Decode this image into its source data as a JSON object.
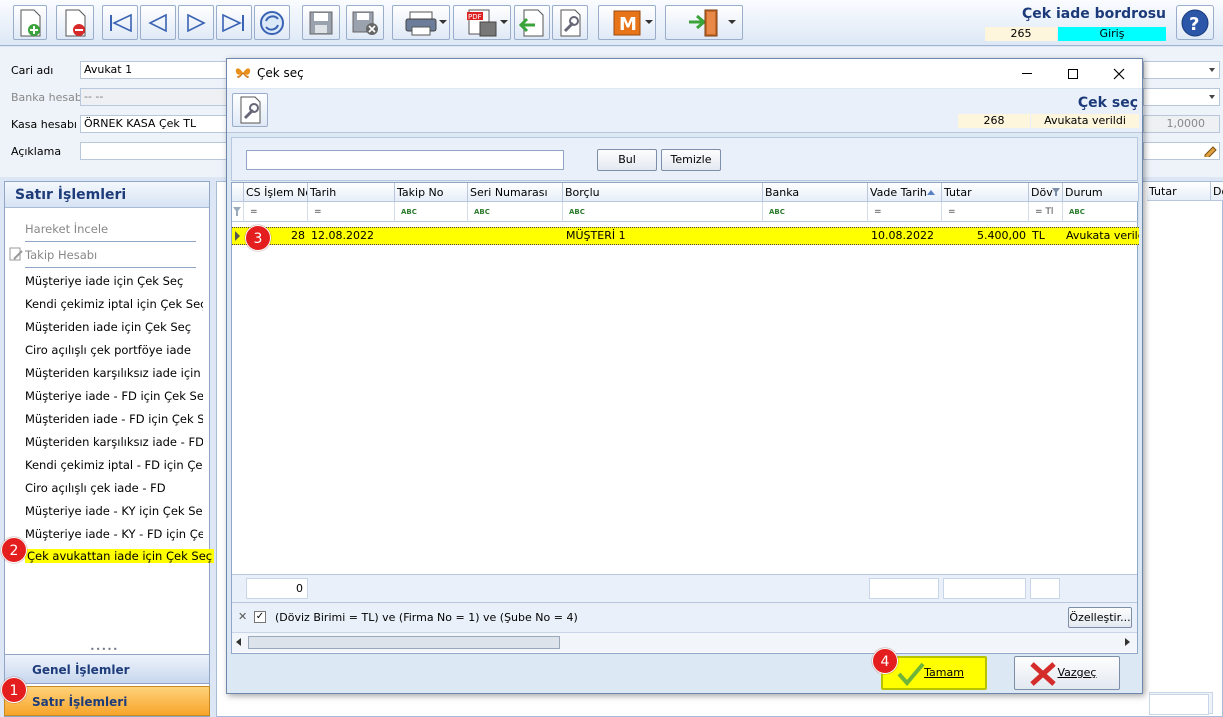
{
  "toolbar": {
    "doc_title": "Çek iade bordrosu",
    "doc_no": "265",
    "doc_status": "Giriş",
    "accent_cyan": "#00ffff",
    "icons": [
      "new-doc-icon",
      "delete-doc-icon",
      "first-icon",
      "prev-icon",
      "next-icon",
      "last-icon",
      "refresh-icon",
      "save-icon",
      "save-close-icon",
      "print-icon",
      "pdf-icon",
      "import-icon",
      "settings-icon",
      "m-icon",
      "exit-icon",
      "help-icon"
    ]
  },
  "form": {
    "cari_label": "Cari adı",
    "cari_value": "Avukat 1",
    "banka_label": "Banka hesabı",
    "banka_value": "-- --",
    "kasa_label": "Kasa hesabı",
    "kasa_value": "ÖRNEK KASA Çek TL",
    "aciklama_label": "Açıklama",
    "aciklama_value": "",
    "rate_value": "1,0000"
  },
  "left_panel": {
    "header": "Satır İşlemleri",
    "items": [
      {
        "label": "Hareket İncele",
        "disabled": true
      },
      {
        "label": "Takip Hesabı",
        "disabled": true
      },
      {
        "label": "Müşteriye iade için Çek Seç"
      },
      {
        "label": "Kendi çekimiz iptal için Çek Seç"
      },
      {
        "label": "Müşteriden iade için Çek Seç"
      },
      {
        "label": "Ciro açılışlı çek portföye iade"
      },
      {
        "label": "Müşteriden karşılıksız iade için ..."
      },
      {
        "label": "Müşteriye iade - FD için Çek Seç"
      },
      {
        "label": "Müşteriden iade - FD için Çek Seç"
      },
      {
        "label": "Müşteriden karşılıksız iade - FD i..."
      },
      {
        "label": "Kendi çekimiz iptal - FD için Çe..."
      },
      {
        "label": "Ciro açılışlı çek iade - FD"
      },
      {
        "label": "Müşteriye iade - KY için Çek Seç"
      },
      {
        "label": "Müşteriye iade - KY - FD için Çe..."
      },
      {
        "label": "Çek avukattan iade için Çek Seç",
        "highlight": true
      }
    ],
    "accordion": [
      {
        "label": "Genel İşlemler"
      },
      {
        "label": "Satır İşlemleri",
        "active": true
      }
    ]
  },
  "background_grid": {
    "columns": [
      "Tutar",
      "Dö"
    ]
  },
  "dialog": {
    "title": "Çek seç",
    "header_title": "Çek seç",
    "doc_no": "268",
    "status": "Avukata verildi",
    "search_value": "",
    "find_button": "Bul",
    "clear_button": "Temizle",
    "columns": [
      "CS İşlem No",
      "Tarih",
      "Takip No",
      "Seri Numarası",
      "Borçlu",
      "Banka",
      "Vade Tarih",
      "Tutar",
      "Döv",
      "Durum"
    ],
    "filter_row": [
      "=",
      "=",
      "ABC",
      "ABC",
      "ABC",
      "ABC",
      "=",
      "=",
      "= Tl",
      "ABC"
    ],
    "rows": [
      {
        "cs_no": "28",
        "tarih": "12.08.2022",
        "takip_no": "",
        "seri_no": "",
        "borclu": "MÜŞTERİ 1",
        "banka": "",
        "vade": "10.08.2022",
        "tutar": "5.400,00",
        "doviz": "TL",
        "durum": "Avukata verildi"
      }
    ],
    "footer_count": "0",
    "filter_text": "(Döviz Birimi = TL) ve (Firma No = 1) ve (Şube No = 4)",
    "customize_button": "Özelleştir...",
    "ok_button": "Tamam",
    "cancel_button": "Vazgeç",
    "highlight_color": "#ffff00"
  },
  "badges": [
    "1",
    "2",
    "3",
    "4"
  ]
}
